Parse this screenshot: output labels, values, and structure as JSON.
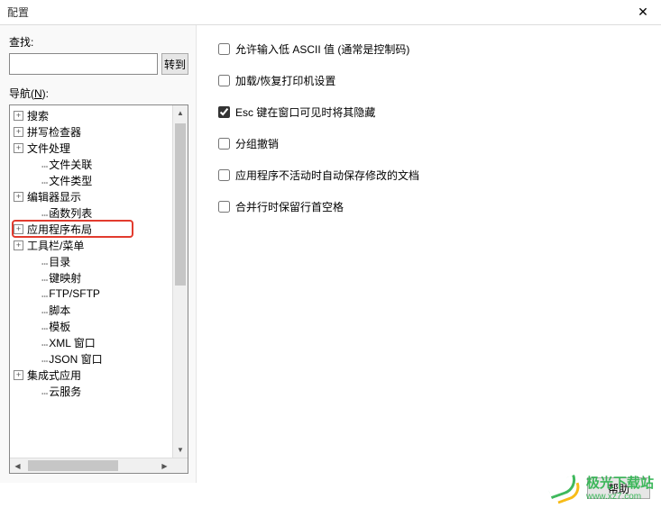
{
  "window": {
    "title": "配置"
  },
  "find": {
    "label": "查找:",
    "value": "",
    "goto": "转到"
  },
  "nav": {
    "label_pre": "导航(",
    "label_key": "N",
    "label_post": "):",
    "items": [
      {
        "expand": "+",
        "label": "搜索",
        "child": false
      },
      {
        "expand": "+",
        "label": "拼写检查器",
        "child": false
      },
      {
        "expand": "+",
        "label": "文件处理",
        "child": false
      },
      {
        "expand": "",
        "label": "文件关联",
        "child": true
      },
      {
        "expand": "",
        "label": "文件类型",
        "child": true
      },
      {
        "expand": "+",
        "label": "编辑器显示",
        "child": false
      },
      {
        "expand": "",
        "label": "函数列表",
        "child": true
      },
      {
        "expand": "+",
        "label": "应用程序布局",
        "child": false,
        "highlight": true
      },
      {
        "expand": "+",
        "label": "工具栏/菜单",
        "child": false
      },
      {
        "expand": "",
        "label": "目录",
        "child": true
      },
      {
        "expand": "",
        "label": "键映射",
        "child": true
      },
      {
        "expand": "",
        "label": "FTP/SFTP",
        "child": true
      },
      {
        "expand": "",
        "label": "脚本",
        "child": true
      },
      {
        "expand": "",
        "label": "模板",
        "child": true
      },
      {
        "expand": "",
        "label": "XML 窗口",
        "child": true
      },
      {
        "expand": "",
        "label": "JSON 窗口",
        "child": true
      },
      {
        "expand": "+",
        "label": "集成式应用",
        "child": false
      },
      {
        "expand": "",
        "label": "云服务",
        "child": true
      }
    ]
  },
  "options": [
    {
      "checked": false,
      "label": "允许输入低 ASCII 值 (通常是控制码)"
    },
    {
      "checked": false,
      "label": "加载/恢复打印机设置"
    },
    {
      "checked": true,
      "label": "Esc 键在窗口可见时将其隐藏"
    },
    {
      "checked": false,
      "label": "分组撤销"
    },
    {
      "checked": false,
      "label": "应用程序不活动时自动保存修改的文档"
    },
    {
      "checked": false,
      "label": "合并行时保留行首空格"
    }
  ],
  "footer": {
    "help": "帮助"
  },
  "watermark": {
    "cn": "极光下载站",
    "url": "www.xz7.com"
  }
}
